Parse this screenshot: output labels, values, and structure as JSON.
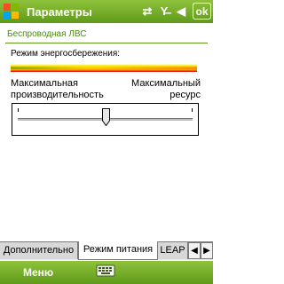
{
  "title_bar": {
    "title": "Параметры",
    "ok_label": "ok",
    "icons": [
      "connectivity-icon",
      "signal-off-icon",
      "volume-icon"
    ],
    "color": "#6fa82a"
  },
  "section": {
    "title": "Беспроводная ЛВС",
    "color": "#4a8a10"
  },
  "power_mode": {
    "label": "Режим энергосбережения:",
    "left_label_line1": "Максимальная",
    "left_label_line2": "производительность",
    "right_label_line1": "Максимальный",
    "right_label_line2": "ресурс",
    "slider_value": 0.5
  },
  "tabs": [
    {
      "label": "Дополнительно",
      "active": false
    },
    {
      "label": "Режим питания",
      "active": true
    },
    {
      "label": "LEAP",
      "active": false
    }
  ],
  "bottom_bar": {
    "menu_label": "Меню",
    "keyboard_icon": "keyboard-icon"
  }
}
